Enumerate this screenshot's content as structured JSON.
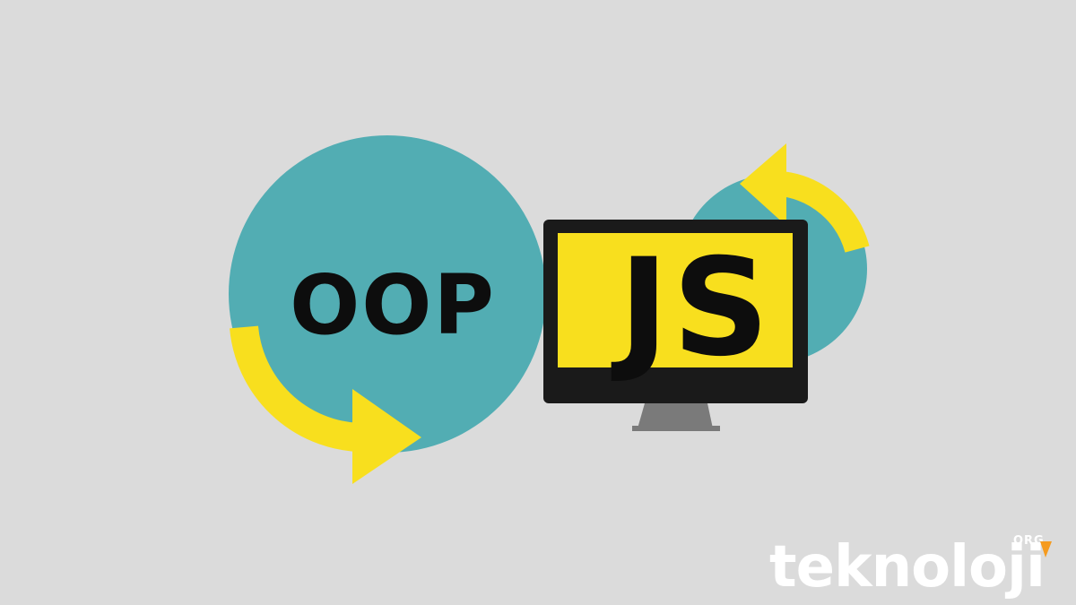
{
  "illustration": {
    "left_label": "OOP",
    "monitor_label": "JS"
  },
  "brand": {
    "name": "teknoloji",
    "suffix": "ORG"
  },
  "colors": {
    "background": "#dbdbdb",
    "circle_teal": "#52adb3",
    "accent_yellow": "#f8df1e",
    "monitor_border": "#1a1a1a",
    "monitor_stand": "#7a7a7a",
    "logo_white": "#ffffff",
    "logo_accent": "#f59b1f"
  },
  "icons": [
    "curved-arrow-icon",
    "curved-arrow-icon",
    "monitor-icon",
    "teknoloji-logo"
  ]
}
